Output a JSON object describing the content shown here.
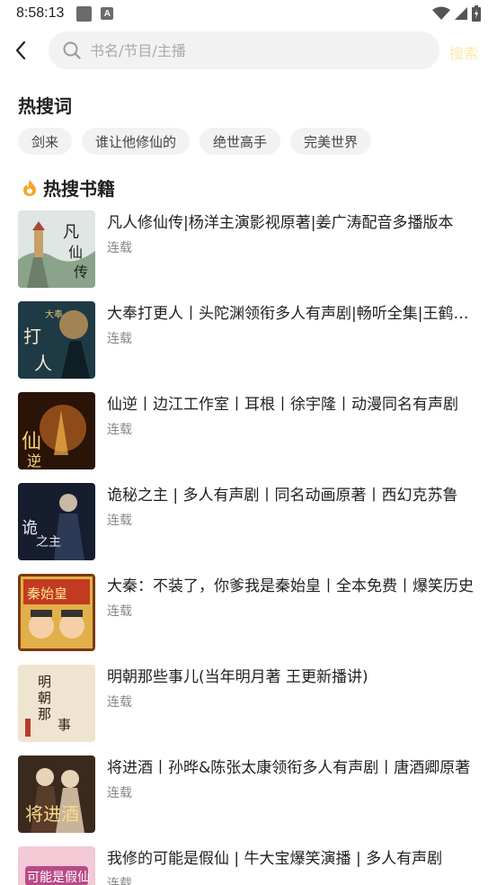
{
  "status_bar": {
    "time": "8:58:13",
    "notif_badge": "A"
  },
  "search": {
    "placeholder": "书名/节目/主播",
    "value": "",
    "action_label": "搜索"
  },
  "hot_words": {
    "title": "热搜词",
    "items": [
      "剑来",
      "谁让他修仙的",
      "绝世高手",
      "完美世界"
    ]
  },
  "hot_books": {
    "title": "热搜书籍",
    "items": [
      {
        "title": "凡人修仙传|杨洋主演影视原著|姜广涛配音多播版本",
        "status": "连载"
      },
      {
        "title": "大奉打更人丨头陀渊领衔多人有声剧|畅听全集|王鹤棣主演剧版原著",
        "status": "连载"
      },
      {
        "title": "仙逆丨边江工作室丨耳根丨徐宇隆丨动漫同名有声剧",
        "status": "连载"
      },
      {
        "title": "诡秘之主 | 多人有声剧丨同名动画原著丨西幻克苏鲁",
        "status": "连载"
      },
      {
        "title": "大秦：不装了，你爹我是秦始皇丨全本免费丨爆笑历史",
        "status": "连载"
      },
      {
        "title": "明朝那些事儿(当年明月著 王更新播讲)",
        "status": "连载"
      },
      {
        "title": "将进酒丨孙晔&陈张太康领衔多人有声剧丨唐酒卿原著",
        "status": "连载"
      },
      {
        "title": "我修的可能是假仙 | 牛大宝爆笑演播 | 多人有声剧",
        "status": "连载"
      }
    ]
  },
  "colors": {
    "accent_flame": "#f5a623",
    "search_action": "#fbe9a8"
  }
}
